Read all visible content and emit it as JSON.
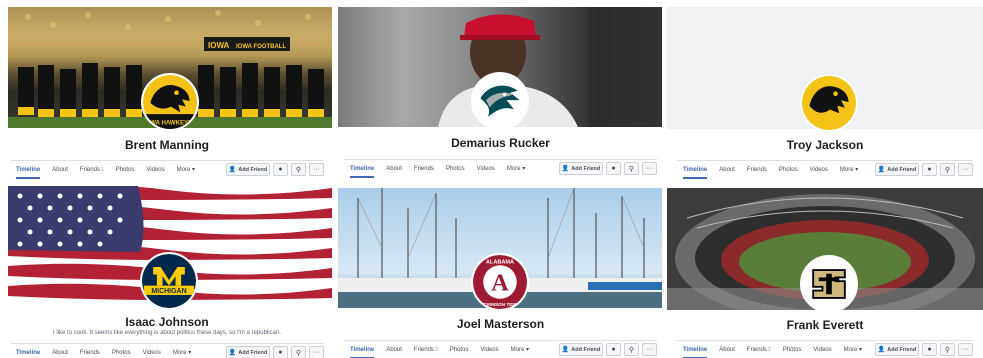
{
  "profiles": [
    {
      "name": "Brent Manning",
      "cover": "Iowa football team with Herky mascot in stadium",
      "cover_text": [
        "IOWA",
        "IOWA FOOTBALL"
      ],
      "avatar_text": "IOWA HAWKEYES",
      "avatar": "iowa-hawkeye-logo",
      "friends_count": "1",
      "tabs": [
        "Timeline",
        "About",
        "Friends",
        "Photos",
        "Videos",
        "More"
      ]
    },
    {
      "name": "Demarius Rucker",
      "cover": "Man in red cap",
      "avatar": "eagles-logo",
      "friends_count": "",
      "tabs": [
        "Timeline",
        "About",
        "Friends",
        "Photos",
        "Videos",
        "More"
      ]
    },
    {
      "name": "Troy Jackson",
      "cover": "blank gray",
      "avatar": "iowa-hawkeye-logo",
      "friends_count": "",
      "tabs": [
        "Timeline",
        "About",
        "Friends",
        "Photos",
        "Videos",
        "More"
      ]
    },
    {
      "name": "Isaac Johnson",
      "bio": "I like to cook. It seems like everything is about politics these days, so I'm a republican.",
      "cover": "Waving American flag",
      "avatar": "michigan-logo",
      "avatar_text": "MICHIGAN",
      "friends_count": "",
      "tabs": [
        "Timeline",
        "About",
        "Friends",
        "Photos",
        "Videos",
        "More"
      ]
    },
    {
      "name": "Joel Masterson",
      "cover": "Marina with sailboats",
      "avatar": "alabama-logo",
      "avatar_text": [
        "ALABAMA",
        "CRIMSON TIDE"
      ],
      "friends_count": "3",
      "tabs": [
        "Timeline",
        "About",
        "Friends",
        "Photos",
        "Videos",
        "More"
      ]
    },
    {
      "name": "Frank Everett",
      "cover": "Aerial view of football stadium",
      "avatar": "colorado-buffaloes-logo",
      "friends_count": "2",
      "tabs": [
        "Timeline",
        "About",
        "Friends",
        "Photos",
        "Videos",
        "More"
      ]
    }
  ],
  "labels": {
    "add_friend": "Add Friend",
    "more_caret": "▾",
    "ellipsis": "···"
  },
  "colors": {
    "facebook_blue": "#4267b2",
    "iowa_gold": "#f5c316",
    "michigan_blue": "#00274c",
    "michigan_maize": "#ffcb05",
    "alabama_crimson": "#9e1b32",
    "colorado_gold": "#cfb87c"
  }
}
